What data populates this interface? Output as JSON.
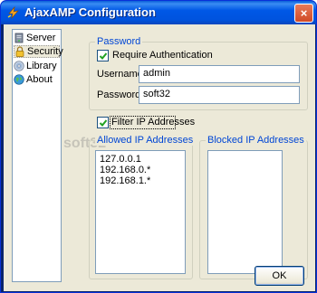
{
  "window": {
    "title": "AjaxAMP Configuration",
    "title_icon": "lightning-icon",
    "close_glyph": "×"
  },
  "nav": {
    "items": [
      {
        "label": "Server",
        "icon": "server-icon"
      },
      {
        "label": "Security",
        "icon": "lock-icon",
        "selected": true
      },
      {
        "label": "Library",
        "icon": "cd-icon"
      },
      {
        "label": "About",
        "icon": "globe-icon"
      }
    ]
  },
  "password_group": {
    "legend": "Password",
    "require_auth_label": "Require Authentication",
    "require_auth_checked": true,
    "username_label": "Username",
    "username_value": "admin",
    "password_label": "Password",
    "password_value": "soft32"
  },
  "filter": {
    "label": "Filter IP Addresses",
    "checked": true
  },
  "allowed_group": {
    "legend": "Allowed IP Addresses",
    "items": [
      "127.0.0.1",
      "192.168.0.*",
      "192.168.1.*"
    ]
  },
  "blocked_group": {
    "legend": "Blocked IP Addresses",
    "items": []
  },
  "ok_label": "OK",
  "watermark": "soft32"
}
